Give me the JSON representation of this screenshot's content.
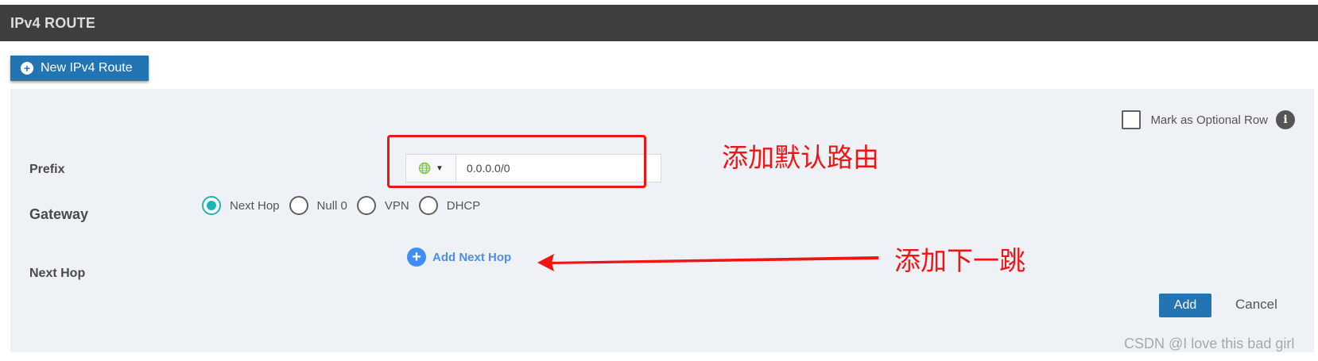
{
  "header": {
    "title": "IPv4 ROUTE"
  },
  "toolbar": {
    "new_route_label": "New IPv4 Route"
  },
  "form": {
    "optional_row_label": "Mark as Optional Row",
    "optional_row_checked": false,
    "prefix_label": "Prefix",
    "prefix_value": "0.0.0.0/0",
    "gateway_label": "Gateway",
    "gateway_options": [
      "Next Hop",
      "Null 0",
      "VPN",
      "DHCP"
    ],
    "gateway_selected": "Next Hop",
    "next_hop_label": "Next Hop",
    "add_next_hop_label": "Add Next Hop"
  },
  "actions": {
    "add_label": "Add",
    "cancel_label": "Cancel"
  },
  "annotations": {
    "default_route_note": "添加默认路由",
    "next_hop_note": "添加下一跳"
  },
  "watermark": "CSDN @I love this bad girl",
  "colors": {
    "header_bg": "#3d3e40",
    "primary_blue": "#2374b3",
    "radio_teal": "#1fb5b5",
    "link_blue": "#4b8fe6",
    "annotation_red": "#f01515",
    "panel_bg": "#eef1f6"
  },
  "icons": {
    "new_route": "plus-circle-icon",
    "ip_type": "globe-icon",
    "info": "info-icon",
    "add_next_hop": "plus-circle-icon"
  }
}
